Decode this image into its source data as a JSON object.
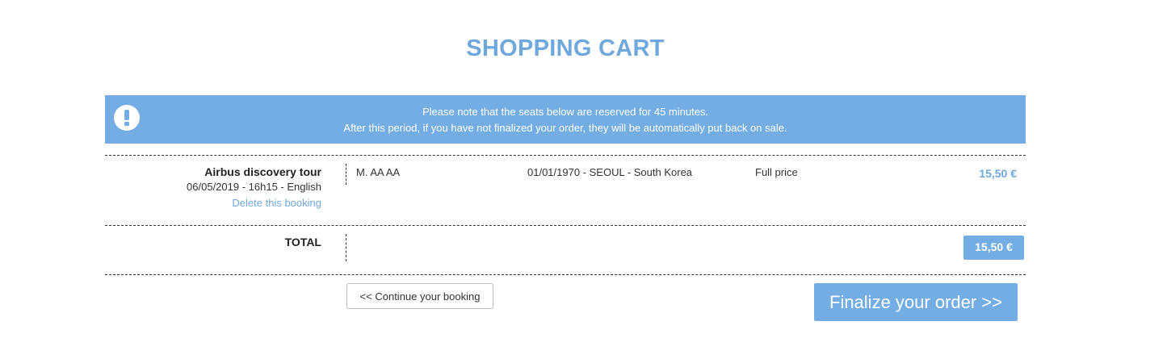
{
  "page": {
    "title": "SHOPPING CART"
  },
  "notice": {
    "icon": "exclamation-circle-icon",
    "line1": "Please note that the seats below are reserved for 45 minutes.",
    "line2": "After this period, if you have not finalized your order, they will be automatically put back on sale."
  },
  "booking": {
    "tour_name": "Airbus discovery tour",
    "tour_meta": "06/05/2019 - 16h15 - English",
    "delete_label": "Delete this booking",
    "passenger_name": "M. AA AA",
    "passenger_details": "01/01/1970 - SEOUL - South Korea",
    "rate": "Full price",
    "price": "15,50 €"
  },
  "total": {
    "label": "TOTAL",
    "amount": "15,50 €"
  },
  "actions": {
    "continue_label": "<< Continue your booking",
    "finalize_label": "Finalize your order >>"
  },
  "colors": {
    "accent": "#74ade3",
    "title": "#6fa8dc",
    "text": "#333333"
  }
}
